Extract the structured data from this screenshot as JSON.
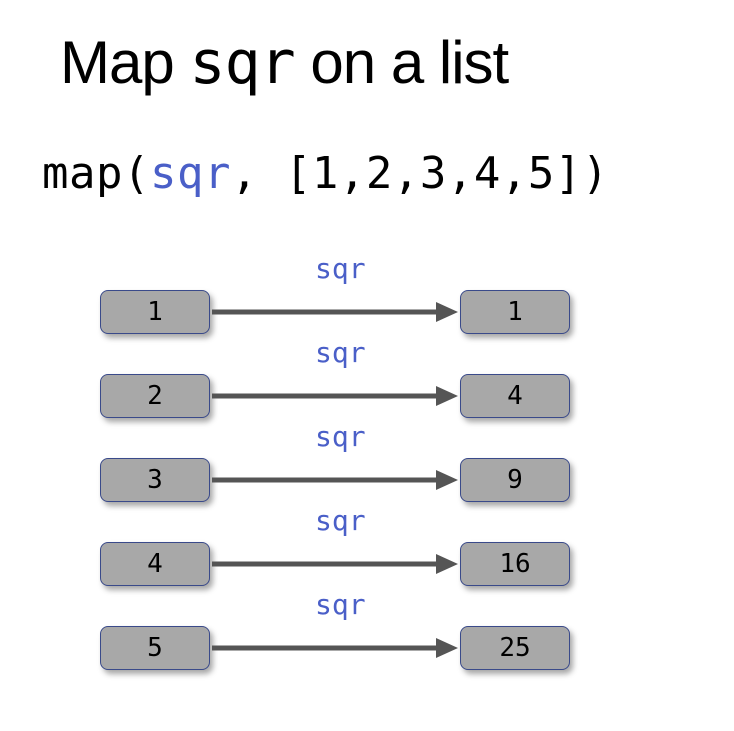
{
  "title_prefix": "Map ",
  "title_mono": "sqr",
  "title_suffix": " on a list",
  "code": {
    "prefix": "map(",
    "fn": "sqr",
    "suffix": ", [1,2,3,4,5])"
  },
  "fn_label": "sqr",
  "colors": {
    "highlight": "#4a5fc8",
    "box_fill": "#a8a8a8",
    "box_border": "#3a4a8a",
    "arrow": "#555"
  },
  "rows": [
    {
      "input": "1",
      "output": "1"
    },
    {
      "input": "2",
      "output": "4"
    },
    {
      "input": "3",
      "output": "9"
    },
    {
      "input": "4",
      "output": "16"
    },
    {
      "input": "5",
      "output": "25"
    }
  ]
}
